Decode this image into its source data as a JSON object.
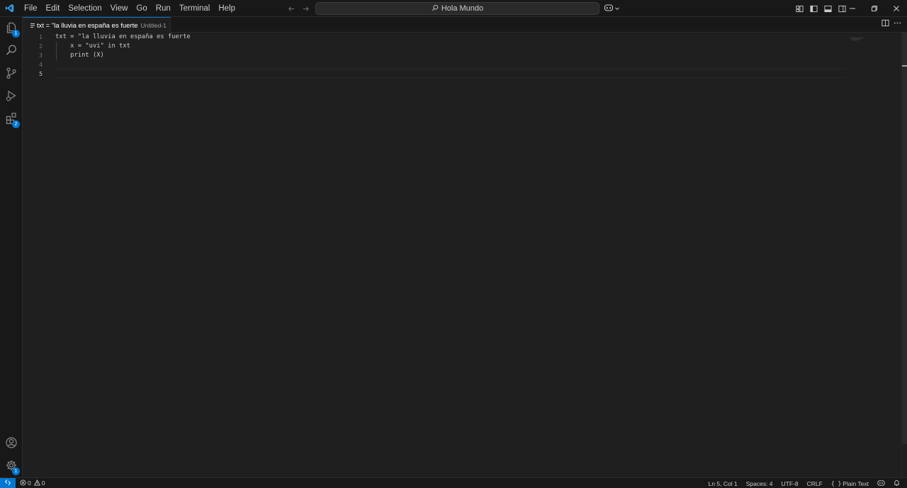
{
  "menu": {
    "items": [
      "File",
      "Edit",
      "Selection",
      "View",
      "Go",
      "Run",
      "Terminal",
      "Help"
    ]
  },
  "command_center": {
    "label": "Hola Mundo"
  },
  "activity_bar": {
    "explorer_badge": "1",
    "extensions_badge": "2",
    "manage_badge": "1"
  },
  "tab": {
    "title": "txt = \"la lluvia en españa es fuerte",
    "description": "Untitled-1"
  },
  "editor": {
    "lines": [
      {
        "number": "1",
        "text": "txt = \"la lluvia en españa es fuerte"
      },
      {
        "number": "2",
        "text": "    x = \"uvi\" in txt"
      },
      {
        "number": "3",
        "text": "    print (X)"
      },
      {
        "number": "4",
        "text": ""
      },
      {
        "number": "5",
        "text": ""
      }
    ]
  },
  "status": {
    "errors": "0",
    "warnings": "0",
    "position": "Ln 5, Col 1",
    "spaces": "Spaces: 4",
    "encoding": "UTF-8",
    "eol": "CRLF",
    "language": "Plain Text"
  },
  "colors": {
    "accent": "#0078d4",
    "background": "#1f1f1f",
    "chrome": "#181818"
  }
}
